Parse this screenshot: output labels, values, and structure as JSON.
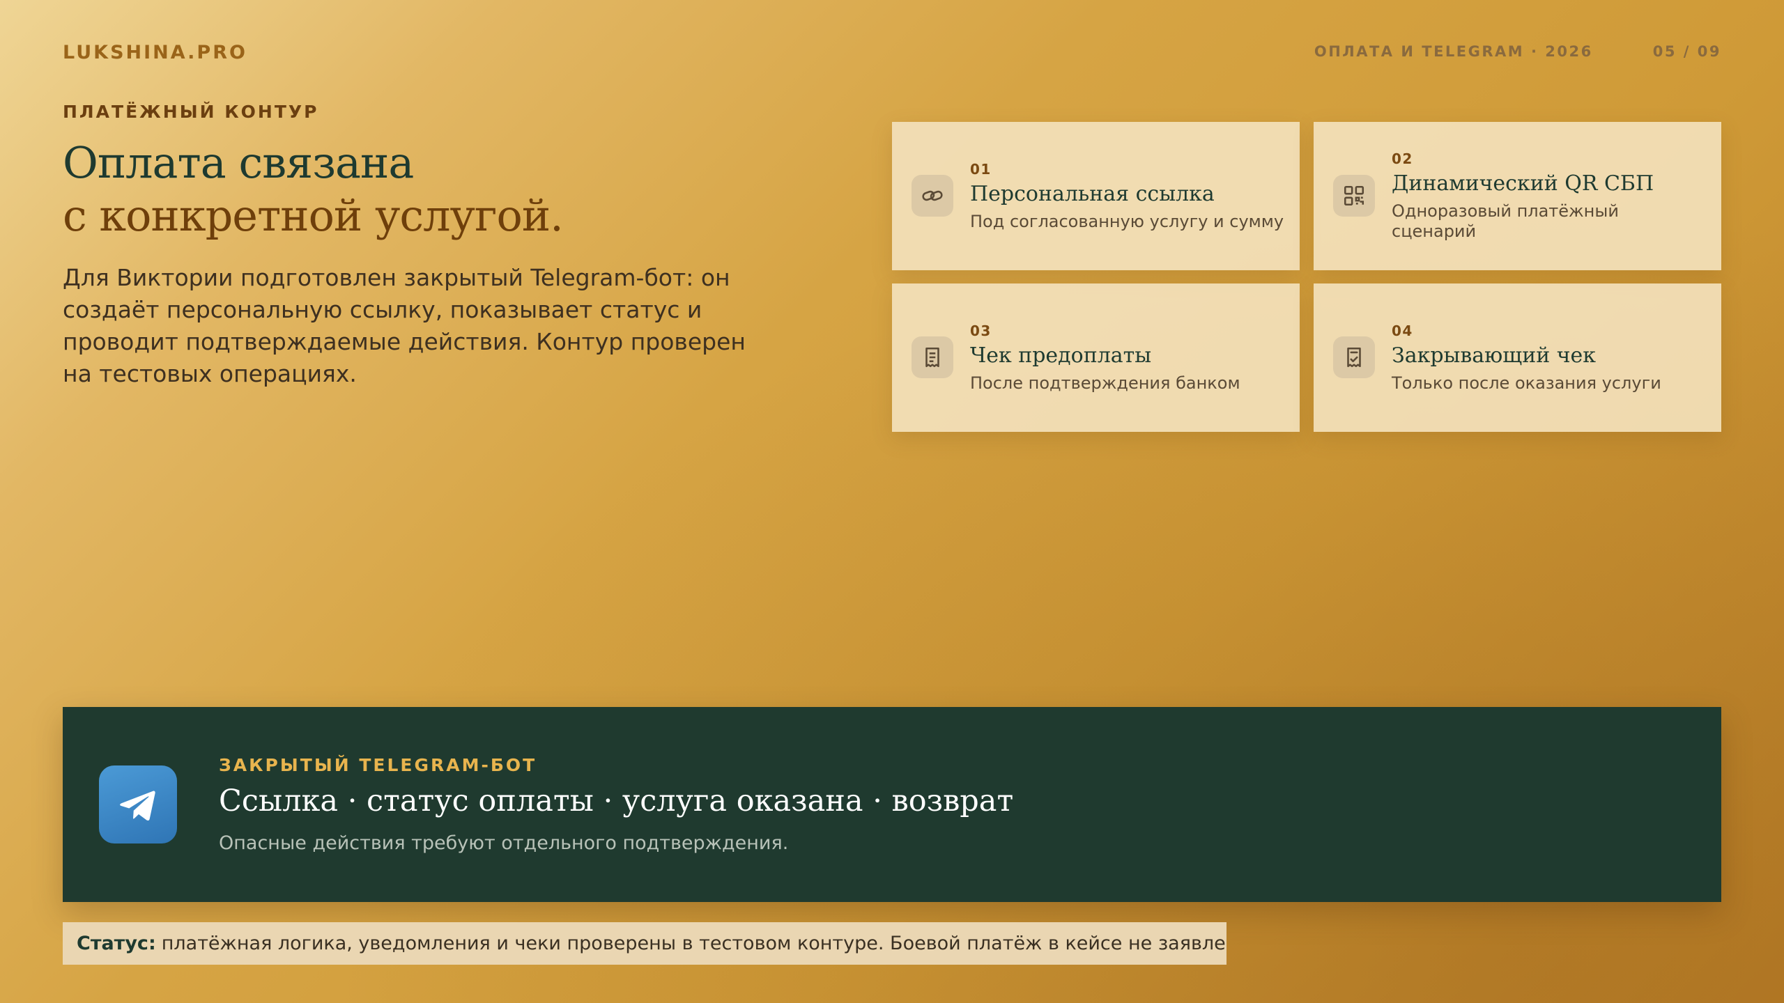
{
  "header": {
    "brand": "LUKSHINA.PRO",
    "section": "ОПЛАТА И TELEGRAM · 2026",
    "page": "05 / 09"
  },
  "intro": {
    "eyebrow": "ПЛАТЁЖНЫЙ КОНТУР",
    "headline_line1": "Оплата связана",
    "headline_line2": "с конкретной услугой.",
    "lead": "Для Виктории подготовлен закрытый Telegram-бот: он создаёт персональную ссылку, показывает статус и проводит подтверждаемые действия. Контур проверен на тестовых операциях."
  },
  "cards": [
    {
      "num": "01",
      "title": "Персональная ссылка",
      "desc": "Под согласованную услугу и сумму",
      "icon": "link-icon"
    },
    {
      "num": "02",
      "title": "Динамический QR СБП",
      "desc": "Одноразовый платёжный сценарий",
      "icon": "qr-code-icon"
    },
    {
      "num": "03",
      "title": "Чек предоплаты",
      "desc": "После подтверждения банком",
      "icon": "receipt-icon"
    },
    {
      "num": "04",
      "title": "Закрывающий чек",
      "desc": "Только после оказания услуги",
      "icon": "receipt-check-icon"
    }
  ],
  "bot": {
    "kicker": "ЗАКРЫТЫЙ TELEGRAM-БОТ",
    "line": "Ссылка · статус оплаты · услуга оказана · возврат",
    "note": "Опасные действия требуют отдельного подтверждения.",
    "icon": "telegram-icon"
  },
  "status": {
    "label": "Статус:",
    "text": "платёжная логика, уведомления и чеки проверены в тестовом контуре. Боевой платёж в кейсе не заявлен."
  },
  "colors": {
    "accent_dark_green": "#1f3a2f",
    "accent_gold": "#e8b44e",
    "brown": "#6e3f0b",
    "telegram_blue": "#2f75b5"
  }
}
